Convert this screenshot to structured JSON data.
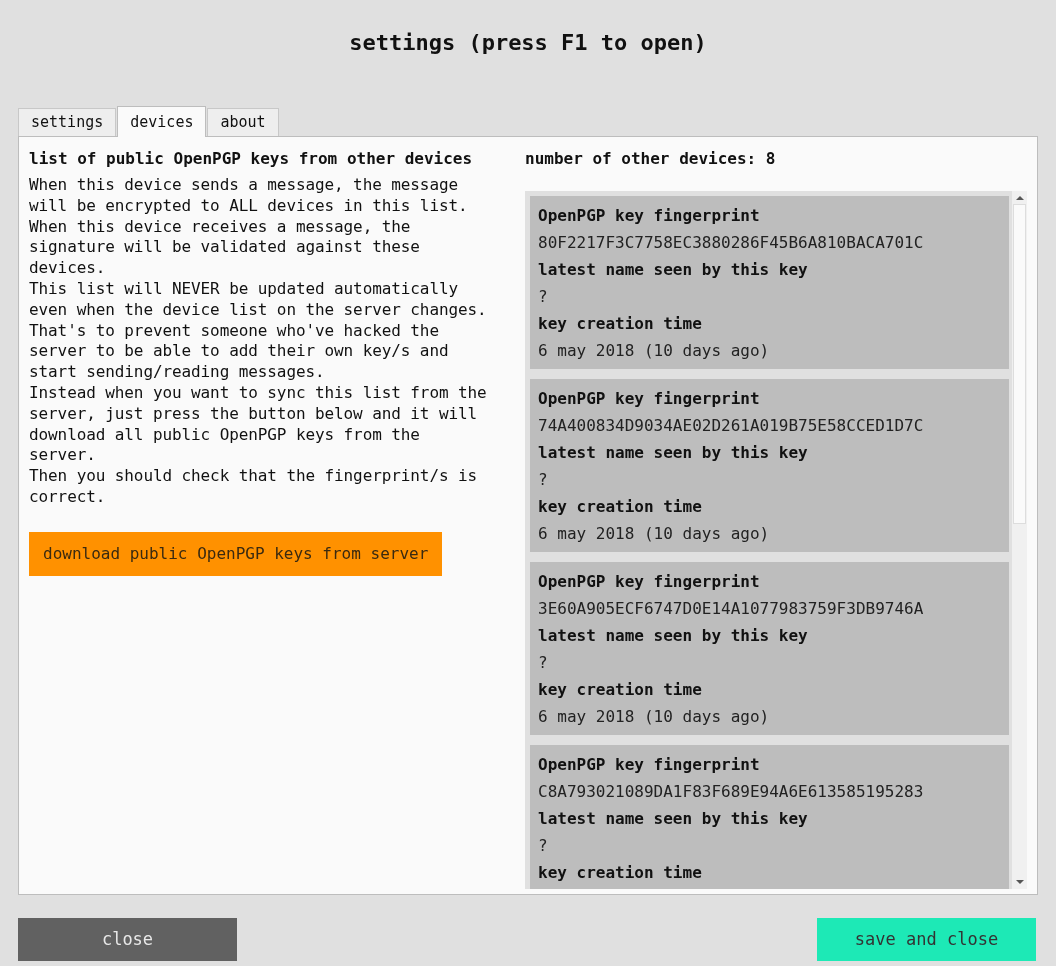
{
  "window": {
    "title": "settings (press F1 to open)"
  },
  "tabs": [
    {
      "label": "settings",
      "selected": false
    },
    {
      "label": "devices",
      "selected": true
    },
    {
      "label": "about",
      "selected": false
    }
  ],
  "left": {
    "heading": "list of public OpenPGP keys from other devices",
    "description": "When this device sends a message, the message\nwill be encrypted to ALL devices in this list.\nWhen this device receives a message, the\nsignature will be validated against these\ndevices.\nThis list will NEVER be updated automatically\neven when the device list on the server changes.\nThat's to prevent someone who've hacked the\nserver to be able to add their own key/s and\nstart sending/reading messages.\nInstead when you want to sync this list from the\nserver, just press the button below and it will\ndownload all public OpenPGP keys from the\nserver.\nThen you should check that the fingerprint/s is\ncorrect.",
    "download_button": "download public OpenPGP keys from server"
  },
  "right": {
    "count_label": "number of other devices: 8",
    "keys": [
      {
        "fingerprint_label": "OpenPGP key fingerprint",
        "fingerprint": "80F2217F3C7758EC3880286F45B6A810BACA701C",
        "name_label": "latest name seen by this key",
        "name": "?",
        "created_label": "key creation time",
        "created": "6 may 2018 (10 days ago)"
      },
      {
        "fingerprint_label": "OpenPGP key fingerprint",
        "fingerprint": "74A400834D9034AE02D261A019B75E58CCED1D7C",
        "name_label": "latest name seen by this key",
        "name": "?",
        "created_label": "key creation time",
        "created": "6 may 2018 (10 days ago)"
      },
      {
        "fingerprint_label": "OpenPGP key fingerprint",
        "fingerprint": "3E60A905ECF6747D0E14A1077983759F3DB9746A",
        "name_label": "latest name seen by this key",
        "name": "?",
        "created_label": "key creation time",
        "created": "6 may 2018 (10 days ago)"
      },
      {
        "fingerprint_label": "OpenPGP key fingerprint",
        "fingerprint": "C8A793021089DA1F83F689E94A6E613585195283",
        "name_label": "latest name seen by this key",
        "name": "?",
        "created_label": "key creation time"
      }
    ]
  },
  "buttons": {
    "close": "close",
    "save": "save and close"
  }
}
